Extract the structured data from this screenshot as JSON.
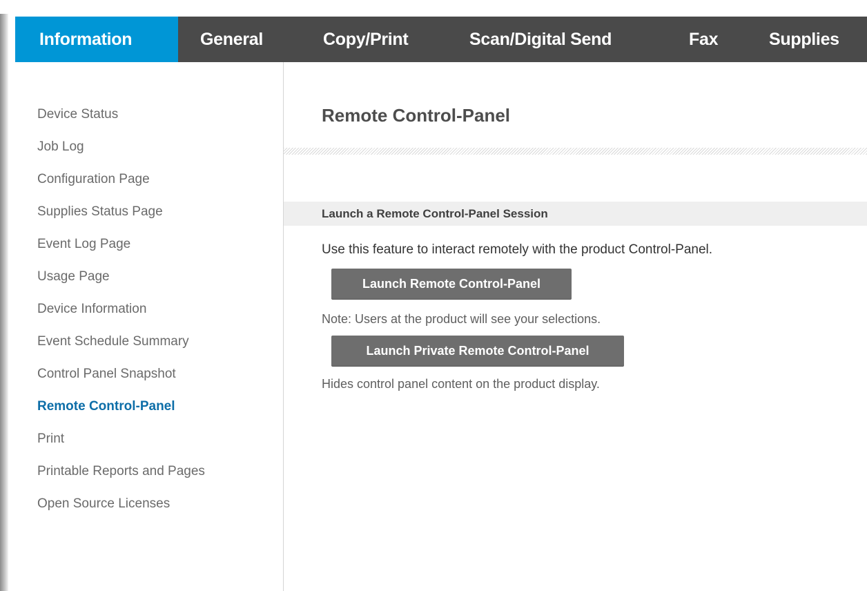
{
  "topnav": {
    "tabs": [
      {
        "label": "Information",
        "active": true
      },
      {
        "label": "General",
        "active": false
      },
      {
        "label": "Copy/Print",
        "active": false
      },
      {
        "label": "Scan/Digital Send",
        "active": false
      },
      {
        "label": "Fax",
        "active": false
      },
      {
        "label": "Supplies",
        "active": false
      }
    ]
  },
  "sidebar": {
    "items": [
      {
        "label": "Device Status"
      },
      {
        "label": "Job Log"
      },
      {
        "label": "Configuration Page"
      },
      {
        "label": "Supplies Status Page"
      },
      {
        "label": "Event Log Page"
      },
      {
        "label": "Usage Page"
      },
      {
        "label": "Device Information"
      },
      {
        "label": "Event Schedule Summary"
      },
      {
        "label": "Control Panel Snapshot"
      },
      {
        "label": "Remote Control-Panel",
        "active": true
      },
      {
        "label": "Print"
      },
      {
        "label": "Printable Reports and Pages"
      },
      {
        "label": "Open Source Licenses"
      }
    ]
  },
  "main": {
    "title": "Remote Control-Panel",
    "section_header": "Launch a Remote Control-Panel Session",
    "description": "Use this feature to interact remotely with the product Control-Panel.",
    "launch_button": "Launch Remote Control-Panel",
    "launch_note": "Note: Users at the product will see your selections.",
    "private_button": "Launch Private Remote Control-Panel",
    "private_note": "Hides control panel content on the product display."
  },
  "colors": {
    "accent": "#0096d6",
    "nav_background": "#4a4a4a",
    "active_link": "#0d6ea8",
    "button": "#6e6e6e"
  }
}
